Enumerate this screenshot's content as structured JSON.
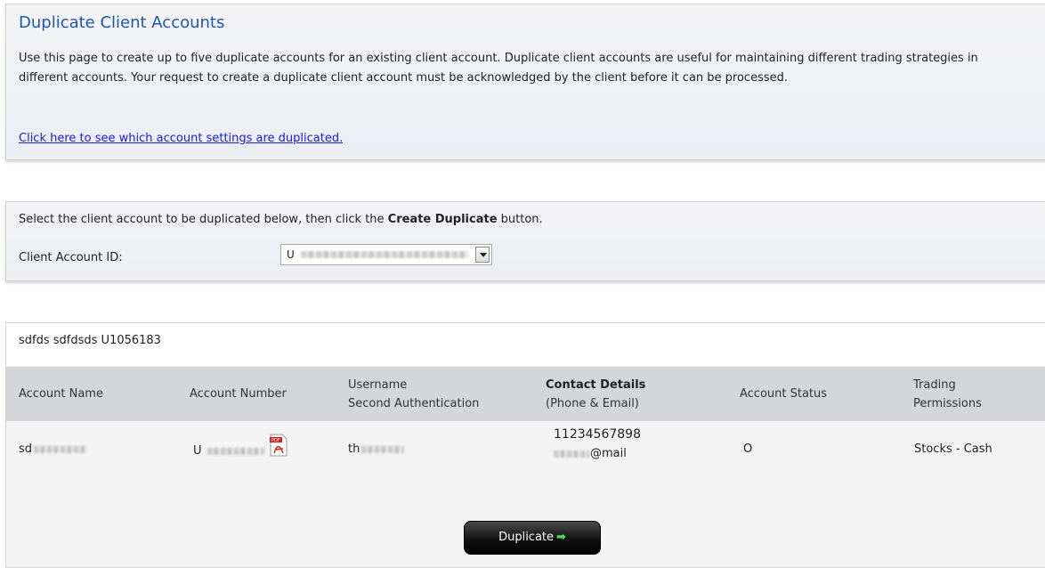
{
  "intro": {
    "title": "Duplicate Client Accounts",
    "text": "Use this page to create up to five duplicate accounts for an existing client account. Duplicate client accounts are useful for maintaining different trading strategies in different accounts. Your request to create a duplicate client account must be acknowledged by the client before it can be processed.",
    "link": "Click here to see which account settings are duplicated."
  },
  "selector": {
    "instruction_prefix": "Select the client account to be duplicated below, then click the ",
    "instruction_bold": "Create Duplicate",
    "instruction_suffix": " button.",
    "label": "Client Account ID:",
    "value": "U"
  },
  "account": {
    "header": "sdfds sdfdsds U1056183",
    "columns": {
      "account_name": "Account Name",
      "account_number": "Account Number",
      "username": "Username",
      "second_auth": "Second Authentication",
      "contact_details": "Contact Details",
      "contact_sub": "(Phone & Email)",
      "account_status": "Account Status",
      "trading": "Trading",
      "permissions": "Permissions"
    },
    "row": {
      "account_name_prefix": "sd",
      "account_number_prefix": "U",
      "username_prefix": "th",
      "phone": "11234567898",
      "email_suffix": "@mail",
      "status": "O",
      "permissions": "Stocks - Cash"
    }
  },
  "actions": {
    "duplicate_label": "Duplicate",
    "duplicate_arrow": "➡"
  },
  "icons": {
    "pdf": "pdf-icon",
    "dropdown": "chevron-down-icon"
  },
  "colors": {
    "title_blue": "#1d55b4",
    "link_blue": "#1a1adb",
    "header_gray": "#d5d6d9",
    "button_black": "#111111",
    "arrow_green": "#4fe04a"
  }
}
